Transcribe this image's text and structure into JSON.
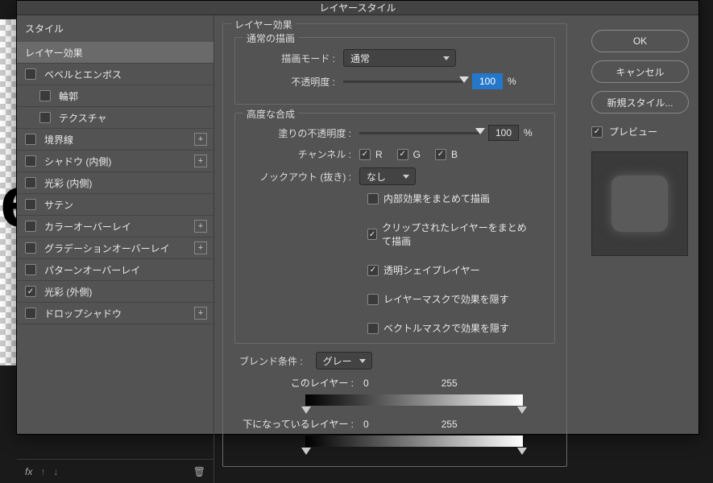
{
  "dialog_title": "レイヤースタイル",
  "styles_header": "スタイル",
  "style_items": [
    {
      "label": "レイヤー効果",
      "selected": true,
      "checkbox": null,
      "plus": false,
      "sub": false
    },
    {
      "label": "ベベルとエンボス",
      "selected": false,
      "checkbox": false,
      "plus": false,
      "sub": false
    },
    {
      "label": "輪郭",
      "selected": false,
      "checkbox": false,
      "plus": false,
      "sub": true
    },
    {
      "label": "テクスチャ",
      "selected": false,
      "checkbox": false,
      "plus": false,
      "sub": true
    },
    {
      "label": "境界線",
      "selected": false,
      "checkbox": false,
      "plus": true,
      "sub": false
    },
    {
      "label": "シャドウ (内側)",
      "selected": false,
      "checkbox": false,
      "plus": true,
      "sub": false
    },
    {
      "label": "光彩 (内側)",
      "selected": false,
      "checkbox": false,
      "plus": false,
      "sub": false
    },
    {
      "label": "サテン",
      "selected": false,
      "checkbox": false,
      "plus": false,
      "sub": false
    },
    {
      "label": "カラーオーバーレイ",
      "selected": false,
      "checkbox": false,
      "plus": true,
      "sub": false
    },
    {
      "label": "グラデーションオーバーレイ",
      "selected": false,
      "checkbox": false,
      "plus": true,
      "sub": false
    },
    {
      "label": "パターンオーバーレイ",
      "selected": false,
      "checkbox": false,
      "plus": false,
      "sub": false
    },
    {
      "label": "光彩 (外側)",
      "selected": false,
      "checkbox": true,
      "plus": false,
      "sub": false
    },
    {
      "label": "ドロップシャドウ",
      "selected": false,
      "checkbox": false,
      "plus": true,
      "sub": false
    }
  ],
  "fx_label": "fx",
  "effects": {
    "section_title": "レイヤー効果",
    "normal_section": "通常の描画",
    "blend_mode_label": "描画モード :",
    "blend_mode_value": "通常",
    "opacity_label": "不透明度 :",
    "opacity_value": "100",
    "pct": "%",
    "advanced_section": "高度な合成",
    "fill_opacity_label": "塗りの不透明度 :",
    "fill_opacity_value": "100",
    "channel_label": "チャンネル :",
    "ch_r": "R",
    "ch_g": "G",
    "ch_b": "B",
    "knockout_label": "ノックアウト (抜き) :",
    "knockout_value": "なし",
    "opt1": "内部効果をまとめて描画",
    "opt2": "クリップされたレイヤーをまとめて描画",
    "opt3": "透明シェイプレイヤー",
    "opt4": "レイヤーマスクで効果を隠す",
    "opt5": "ベクトルマスクで効果を隠す",
    "blend_if_label": "ブレンド条件 :",
    "blend_if_value": "グレー",
    "this_layer_label": "このレイヤー :",
    "this_layer_min": "0",
    "this_layer_max": "255",
    "under_layer_label": "下になっているレイヤー :",
    "under_layer_min": "0",
    "under_layer_max": "255"
  },
  "buttons": {
    "ok": "OK",
    "cancel": "キャンセル",
    "new_style": "新規スタイル..."
  },
  "preview_label": "プレビュー"
}
